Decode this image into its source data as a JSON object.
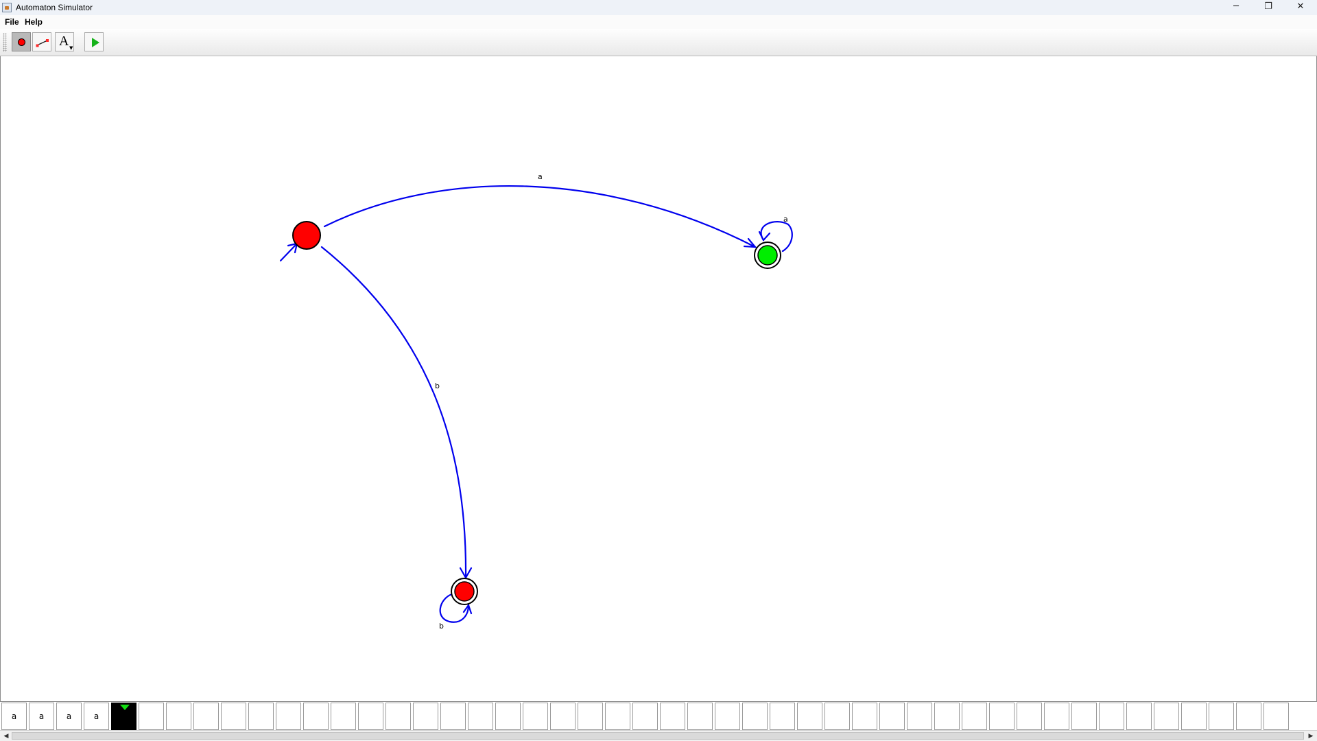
{
  "window": {
    "title": "Automaton Simulator",
    "controls": {
      "minimize": "─",
      "restore": "❐",
      "close": "✕"
    }
  },
  "menu": {
    "items": [
      "File",
      "Help"
    ]
  },
  "toolbar": {
    "tools": [
      {
        "name": "state-tool",
        "icon": "red-circle-icon",
        "selected": true
      },
      {
        "name": "transition-tool",
        "icon": "transition-line-icon",
        "selected": false
      },
      {
        "name": "text-tool",
        "icon": "text-A-icon",
        "glyph": "A",
        "selected": false
      },
      {
        "name": "run-tool",
        "icon": "play-icon",
        "selected": false
      }
    ]
  },
  "automaton": {
    "states": [
      {
        "id": "start",
        "color": "#ff0000",
        "initial": true,
        "accepting": false
      },
      {
        "id": "accept",
        "color": "#00ee00",
        "initial": false,
        "accepting": true
      },
      {
        "id": "sink",
        "color": "#ff0000",
        "initial": false,
        "accepting": true
      }
    ],
    "transitions": [
      {
        "from": "start",
        "to": "accept",
        "label": "a"
      },
      {
        "from": "accept",
        "to": "accept",
        "label": "a"
      },
      {
        "from": "start",
        "to": "sink",
        "label": "b"
      },
      {
        "from": "sink",
        "to": "sink",
        "label": "b"
      }
    ],
    "edge_color": "#0000ee"
  },
  "tape": {
    "symbols": [
      "a",
      "a",
      "a",
      "a"
    ],
    "head_index": 4,
    "head_color": "#11dd11",
    "total_cells": 47
  },
  "scrollbar": {
    "left_arrow": "◀",
    "right_arrow": "▶"
  }
}
